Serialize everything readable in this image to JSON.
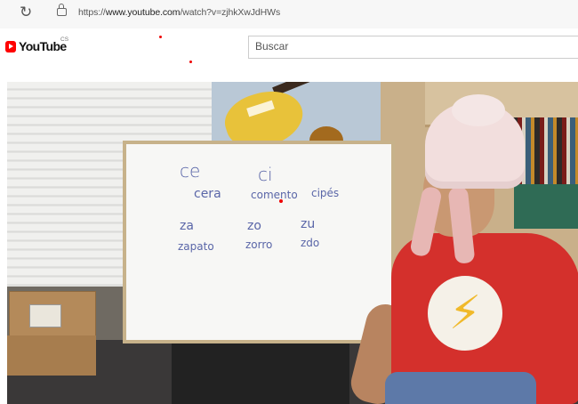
{
  "browser": {
    "reload_icon": "reload-icon",
    "lock_icon": "lock-icon",
    "url_prefix": "https://",
    "url_host": "www.youtube.com",
    "url_path": "/watch?v=zjhkXwJdHWs"
  },
  "youtube": {
    "logo_text": "YouTube",
    "region_code": "CS",
    "search_placeholder": "Buscar"
  },
  "video": {
    "whiteboard": {
      "line1": [
        "ce",
        "ci"
      ],
      "line2": [
        "cera",
        "comento",
        "cipés"
      ],
      "line3": [
        "za",
        "zo",
        "zu"
      ],
      "line4": [
        "zapato",
        "zorro",
        "zdo"
      ]
    },
    "shirt_emblem": "lightning-bolt"
  },
  "colors": {
    "youtube_red": "#ff0000",
    "marker_blue": "#5a66a8",
    "shirt_red": "#d4302c"
  }
}
